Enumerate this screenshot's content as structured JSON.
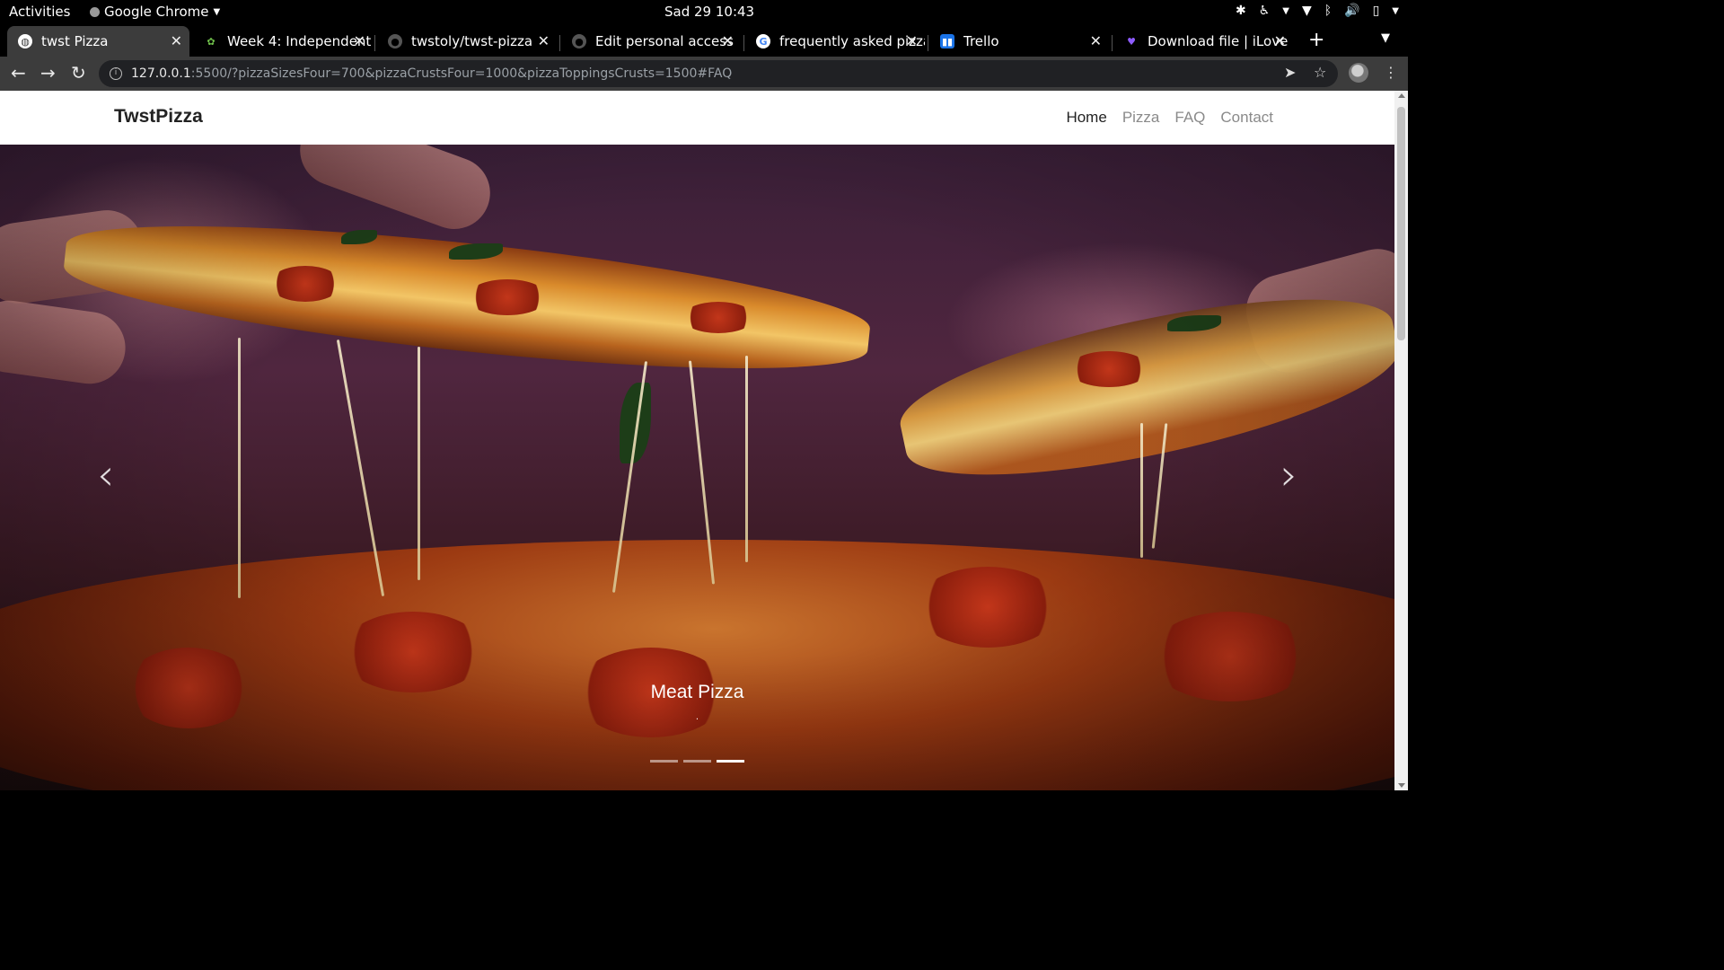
{
  "system": {
    "activities": "Activities",
    "app_name": "Google Chrome",
    "clock": "Sad 29  10:43"
  },
  "browser": {
    "tabs": [
      {
        "title": "twst Pizza",
        "active": true,
        "favicon": "globe-icon"
      },
      {
        "title": "Week 4: Independent",
        "active": false,
        "favicon": "microverse-icon"
      },
      {
        "title": "twstoly/twst-pizza",
        "active": false,
        "favicon": "github-icon"
      },
      {
        "title": "Edit personal access",
        "active": false,
        "favicon": "github-icon"
      },
      {
        "title": "frequently asked pizza",
        "active": false,
        "favicon": "google-icon"
      },
      {
        "title": "Trello",
        "active": false,
        "favicon": "trello-icon"
      },
      {
        "title": "Download file | iLove",
        "active": false,
        "favicon": "ilovepdf-icon"
      }
    ],
    "url_host": "127.0.0.1",
    "url_rest": ":5500/?pizzaSizesFour=700&pizzaCrustsFour=1000&pizzaToppingsCrusts=1500#FAQ"
  },
  "site": {
    "brand": "TwstPizza",
    "nav": [
      {
        "label": "Home",
        "active": true
      },
      {
        "label": "Pizza",
        "active": false
      },
      {
        "label": "FAQ",
        "active": false
      },
      {
        "label": "Contact",
        "active": false
      }
    ],
    "carousel": {
      "caption": "Meat Pizza",
      "subcaption": ".",
      "slide_count": 3,
      "active_slide": 3
    }
  },
  "colors": {
    "topbar_bg": "#000000",
    "toolbar_bg": "#3c3c3c",
    "nav_active": "#222222",
    "nav_inactive": "#8a8a8a"
  }
}
